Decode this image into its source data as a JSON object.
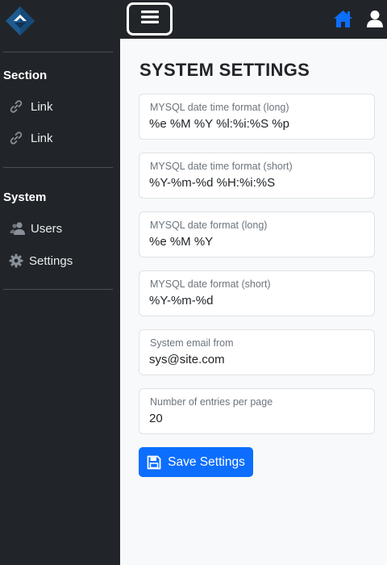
{
  "header": {
    "logo_icon": "diamond-logo-icon",
    "menu_icon": "hamburger-icon",
    "home_icon": "home-icon",
    "user_icon": "user-icon",
    "accent_color": "#0d6efd"
  },
  "sidebar": {
    "sections": [
      {
        "heading": "Section",
        "items": [
          {
            "label": "Link",
            "icon": "link-icon"
          },
          {
            "label": "Link",
            "icon": "link-icon"
          }
        ]
      },
      {
        "heading": "System",
        "items": [
          {
            "label": "Users",
            "icon": "users-icon"
          },
          {
            "label": "Settings",
            "icon": "gear-icon"
          }
        ]
      }
    ]
  },
  "main": {
    "title": "SYSTEM SETTINGS",
    "fields": [
      {
        "label": "MYSQL date time format (long)",
        "value": "%e %M %Y %l:%i:%S %p"
      },
      {
        "label": "MYSQL date time format (short)",
        "value": "%Y-%m-%d %H:%i:%S"
      },
      {
        "label": "MYSQL date format (long)",
        "value": "%e %M %Y"
      },
      {
        "label": "MYSQL date format (short)",
        "value": "%Y-%m-%d"
      },
      {
        "label": "System email from",
        "value": "sys@site.com"
      },
      {
        "label": "Number of entries per page",
        "value": "20"
      }
    ],
    "save_button": {
      "label": "Save Settings",
      "icon": "floppy-disk-icon"
    }
  }
}
